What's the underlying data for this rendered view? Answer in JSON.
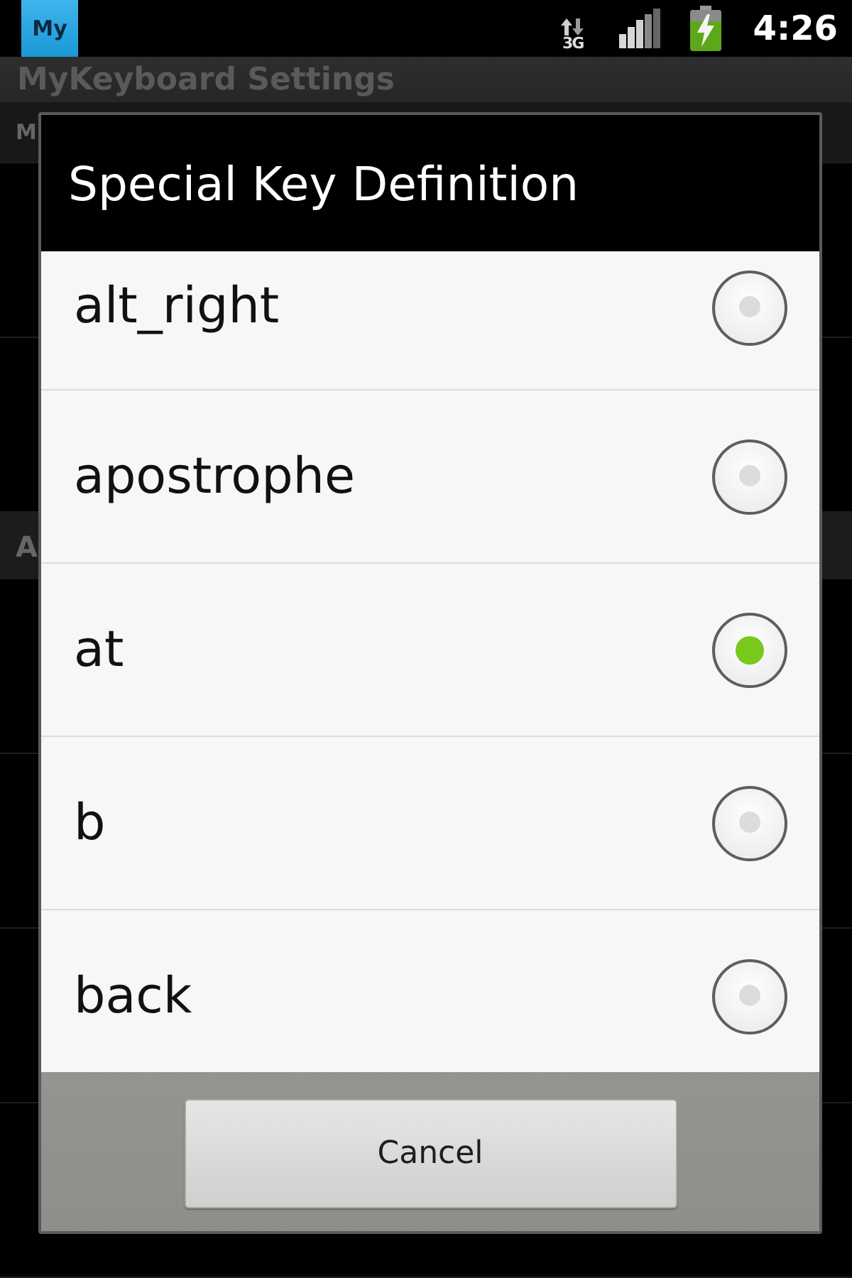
{
  "status_bar": {
    "app_icon_label": "My",
    "network": "3G",
    "time": "4:26"
  },
  "app": {
    "title": "MyKeyboard Settings",
    "rows": [
      {
        "kind": "item",
        "text": "M",
        "selected": true
      },
      {
        "kind": "item",
        "selected": false
      },
      {
        "kind": "item",
        "selected": false
      },
      {
        "kind": "header",
        "text": "A"
      },
      {
        "kind": "item",
        "selected": false
      },
      {
        "kind": "item",
        "selected": false
      },
      {
        "kind": "item",
        "selected": false
      },
      {
        "kind": "item",
        "selected": false
      }
    ]
  },
  "dialog": {
    "title": "Special Key Definition",
    "options": [
      {
        "label": "alt_right",
        "selected": false
      },
      {
        "label": "apostrophe",
        "selected": false
      },
      {
        "label": "at",
        "selected": true
      },
      {
        "label": "b",
        "selected": false
      },
      {
        "label": "back",
        "selected": false
      }
    ],
    "buttons": [
      "Cancel"
    ]
  }
}
